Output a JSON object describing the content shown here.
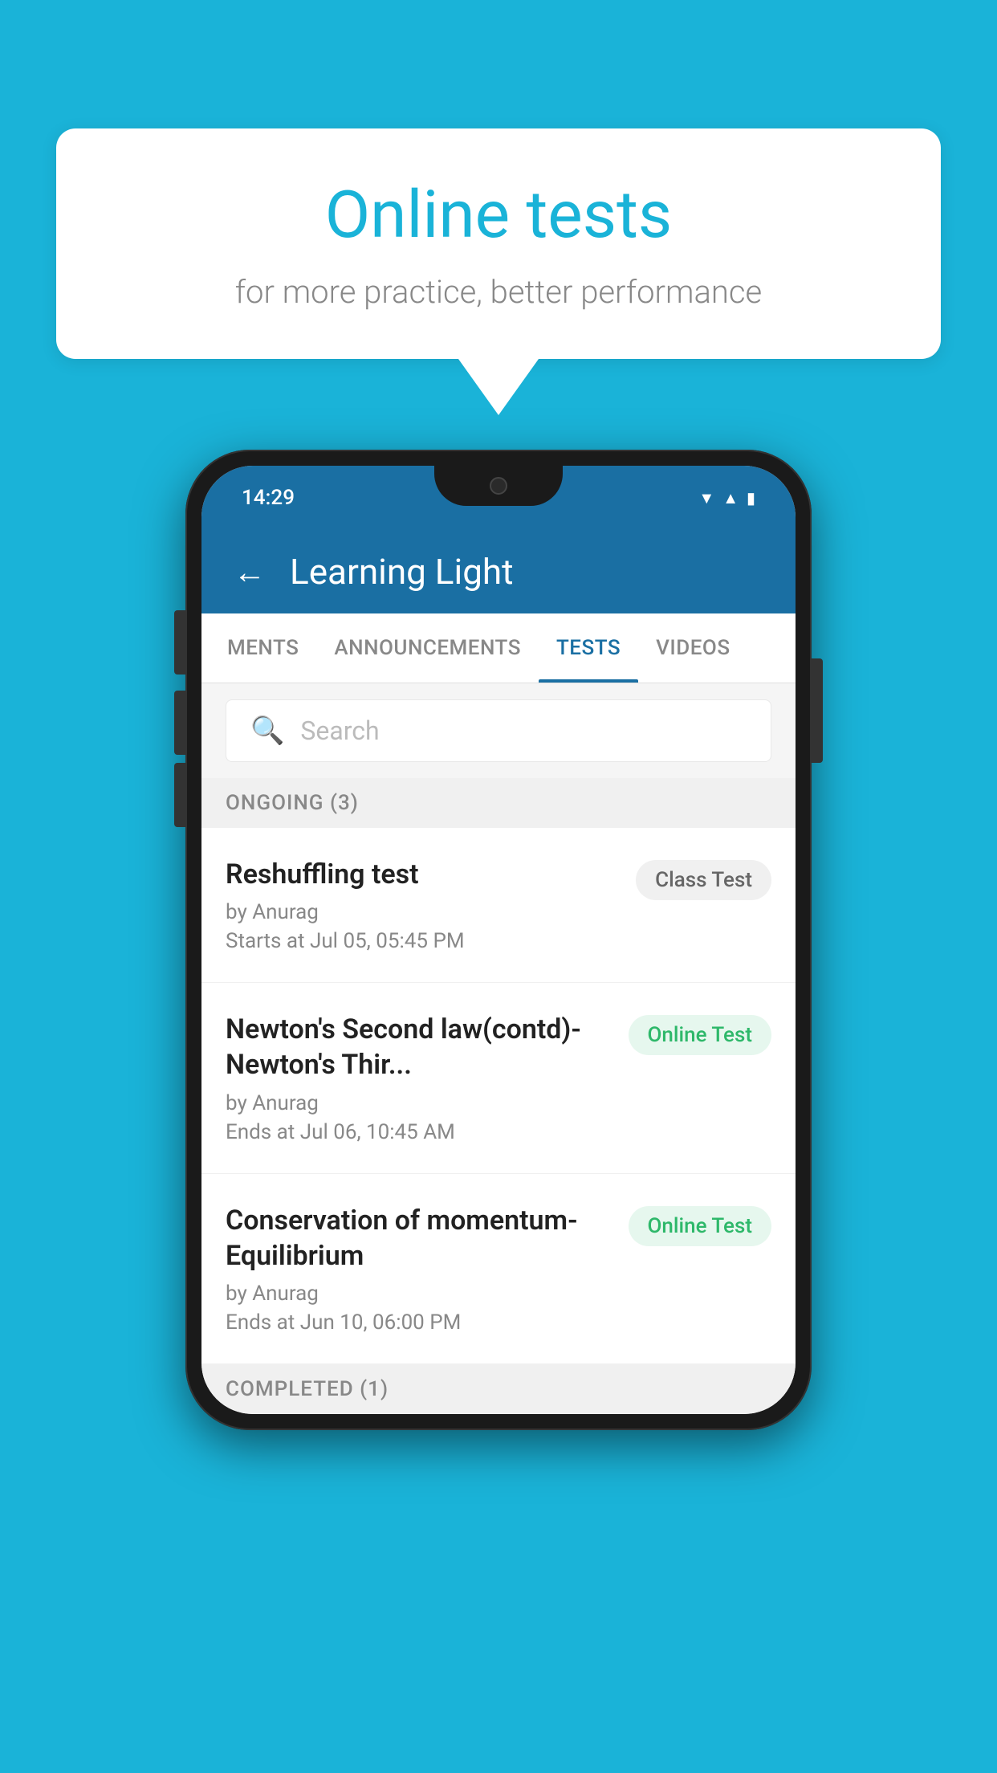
{
  "background_color": "#1ab3d8",
  "bubble": {
    "title": "Online tests",
    "subtitle": "for more practice, better performance"
  },
  "phone": {
    "status_bar": {
      "time": "14:29",
      "icons": [
        "wifi",
        "signal",
        "battery"
      ]
    },
    "header": {
      "title": "Learning Light",
      "back_label": "←"
    },
    "tabs": [
      {
        "label": "MENTS",
        "active": false
      },
      {
        "label": "ANNOUNCEMENTS",
        "active": false
      },
      {
        "label": "TESTS",
        "active": true
      },
      {
        "label": "VIDEOS",
        "active": false
      }
    ],
    "search": {
      "placeholder": "Search"
    },
    "sections": [
      {
        "label": "ONGOING (3)",
        "tests": [
          {
            "title": "Reshuffling test",
            "by": "by Anurag",
            "date": "Starts at  Jul 05, 05:45 PM",
            "badge": "Class Test",
            "badge_type": "class"
          },
          {
            "title": "Newton's Second law(contd)-Newton's Thir...",
            "by": "by Anurag",
            "date": "Ends at  Jul 06, 10:45 AM",
            "badge": "Online Test",
            "badge_type": "online"
          },
          {
            "title": "Conservation of momentum-Equilibrium",
            "by": "by Anurag",
            "date": "Ends at  Jun 10, 06:00 PM",
            "badge": "Online Test",
            "badge_type": "online"
          }
        ]
      }
    ],
    "completed_label": "COMPLETED (1)"
  }
}
